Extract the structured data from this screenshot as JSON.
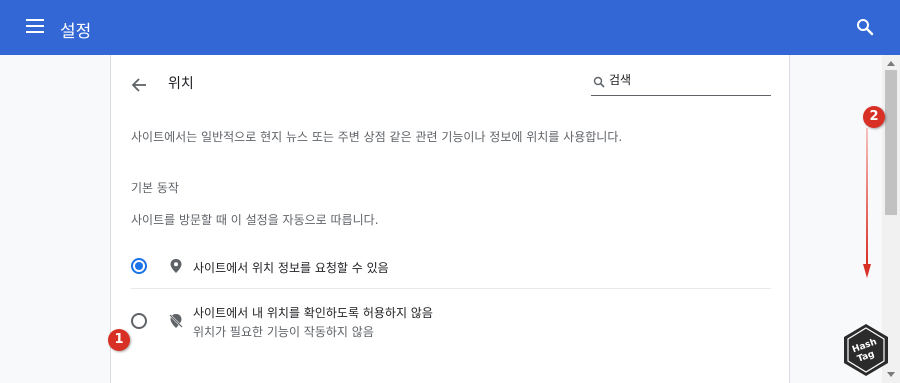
{
  "header": {
    "title": "설정",
    "menu_icon": "hamburger-menu-icon",
    "search_icon": "search-icon",
    "bg_color": "#3367d6"
  },
  "page": {
    "title": "위치",
    "back_icon": "arrow-back-icon",
    "search": {
      "value": "검색",
      "placeholder": "검색"
    },
    "description": "사이트에서는 일반적으로 현지 뉴스 또는 주변 상점 같은 관련 기능이나 정보에 위치를 사용합니다.",
    "default_behavior": {
      "title": "기본 동작",
      "subtitle": "사이트를 방문할 때 이 설정을 자동으로 따릅니다.",
      "options": [
        {
          "label": "사이트에서 위치 정보를 요청할 수 있음",
          "sublabel": "",
          "checked": true,
          "icon": "location-pin-icon"
        },
        {
          "label": "사이트에서 내 위치를 확인하도록 허용하지 않음",
          "sublabel": "위치가 필요한 기능이 작동하지 않음",
          "checked": false,
          "icon": "location-off-icon"
        }
      ]
    }
  },
  "annotations": {
    "badge_1": "1",
    "badge_2": "2",
    "badge_color": "#d93025"
  },
  "logo": {
    "line1": "Hash",
    "line2": "Tag"
  }
}
